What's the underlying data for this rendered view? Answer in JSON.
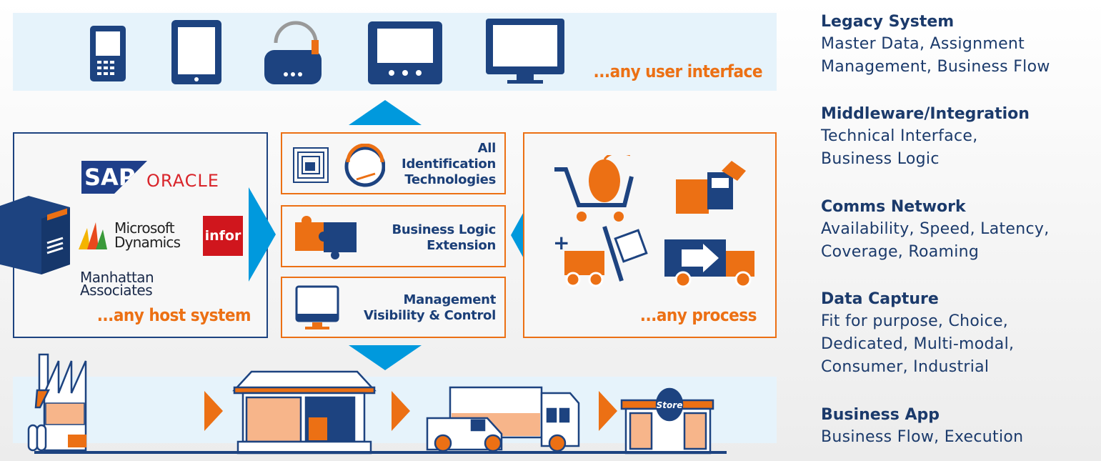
{
  "top_band": {
    "label": "...any user interface"
  },
  "host_box": {
    "label": "...any host system",
    "logos": [
      "SAP",
      "ORACLE",
      "Microsoft Dynamics",
      "infor",
      "Manhattan Associates"
    ]
  },
  "middle": [
    {
      "label_lines": [
        "All",
        "Identification",
        "Technologies"
      ]
    },
    {
      "label_lines": [
        "Business Logic",
        "Extension"
      ]
    },
    {
      "label_lines": [
        "Management",
        "Visibility & Control"
      ]
    }
  ],
  "process_box": {
    "label": "...any process"
  },
  "bottom_band": {
    "store_sign": "Store"
  },
  "sidebar": [
    {
      "title": "Legacy System",
      "lines": [
        "Master Data, Assignment",
        "Management, Business Flow"
      ]
    },
    {
      "title": "Middleware/Integration",
      "lines": [
        "Technical Interface,",
        "Business Logic"
      ]
    },
    {
      "title": "Comms Network",
      "lines": [
        "Availability, Speed, Latency,",
        "Coverage, Roaming"
      ]
    },
    {
      "title": "Data Capture",
      "lines": [
        "Fit for purpose, Choice,",
        "Dedicated, Multi-modal,",
        "Consumer, Industrial"
      ]
    },
    {
      "title": "Business App",
      "lines": [
        "Business Flow, Execution"
      ]
    }
  ],
  "colors": {
    "navy": "#1d4380",
    "orange": "#ec7014",
    "arrow_blue": "#0099dd",
    "band": "#e6f3fb"
  }
}
